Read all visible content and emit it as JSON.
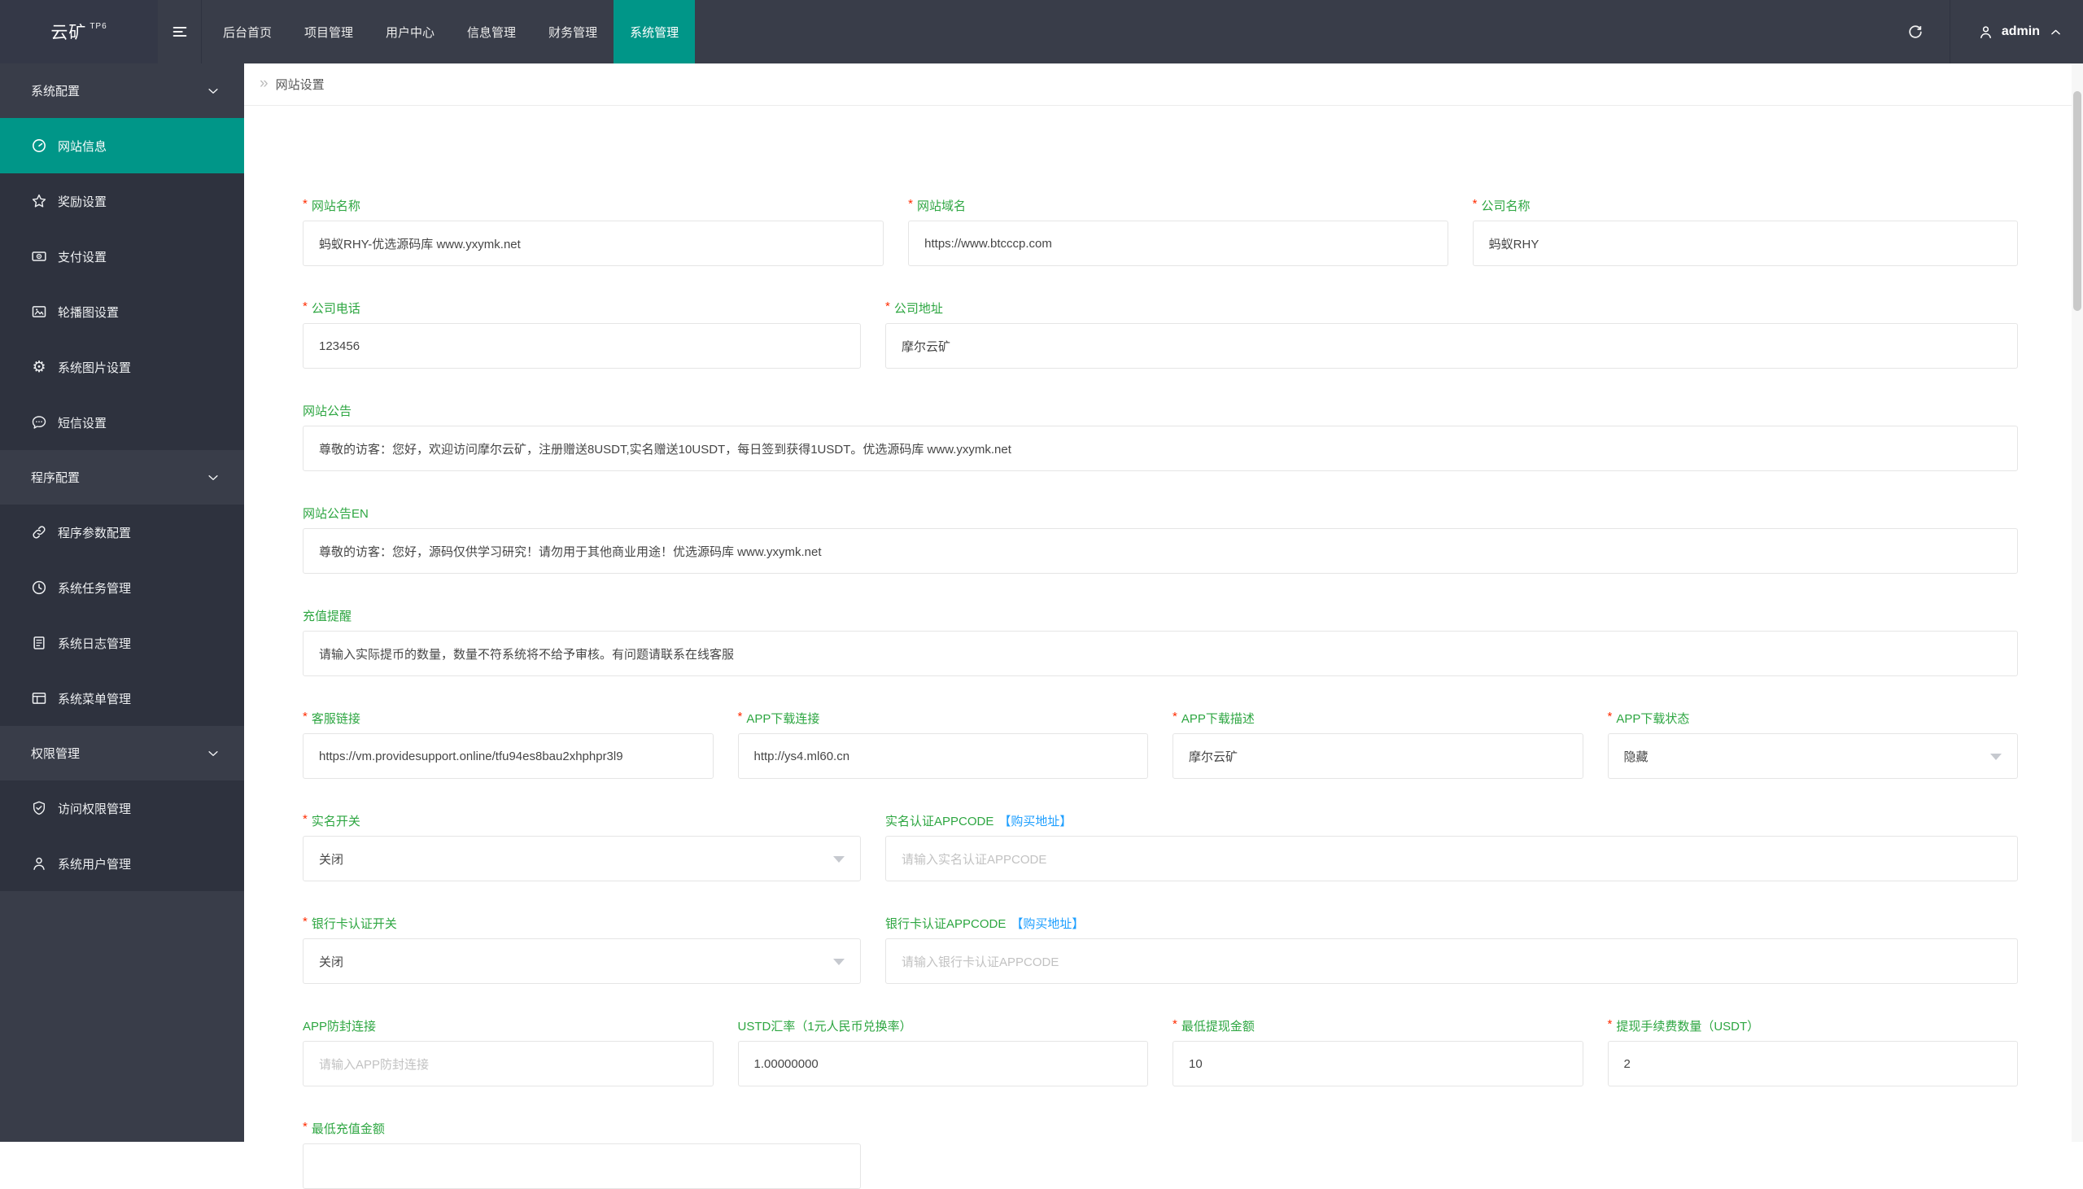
{
  "topbar": {
    "logo_text": "云矿",
    "logo_sup": "TP6",
    "nav": [
      {
        "id": "home",
        "label": "后台首页"
      },
      {
        "id": "project",
        "label": "项目管理"
      },
      {
        "id": "user",
        "label": "用户中心"
      },
      {
        "id": "info",
        "label": "信息管理"
      },
      {
        "id": "finance",
        "label": "财务管理"
      },
      {
        "id": "system",
        "label": "系统管理",
        "active": true
      }
    ],
    "user": "admin"
  },
  "sidebar": {
    "items": [
      {
        "type": "section",
        "id": "system-config",
        "label": "系统配置"
      },
      {
        "type": "item",
        "id": "site-info",
        "label": "网站信息",
        "icon": "gauge",
        "active": true
      },
      {
        "type": "item",
        "id": "reward-setting",
        "label": "奖励设置",
        "icon": "star"
      },
      {
        "type": "item",
        "id": "pay-setting",
        "label": "支付设置",
        "icon": "banknote"
      },
      {
        "type": "item",
        "id": "banner-setting",
        "label": "轮播图设置",
        "icon": "image"
      },
      {
        "type": "item",
        "id": "image-setting",
        "label": "系统图片设置",
        "icon": "gear"
      },
      {
        "type": "item",
        "id": "sms-setting",
        "label": "短信设置",
        "icon": "chat"
      },
      {
        "type": "section",
        "id": "program-config",
        "label": "程序配置"
      },
      {
        "type": "item",
        "id": "program-params",
        "label": "程序参数配置",
        "icon": "link"
      },
      {
        "type": "item",
        "id": "task-manage",
        "label": "系统任务管理",
        "icon": "clock"
      },
      {
        "type": "item",
        "id": "log-manage",
        "label": "系统日志管理",
        "icon": "log"
      },
      {
        "type": "item",
        "id": "menu-manage",
        "label": "系统菜单管理",
        "icon": "menu-window"
      },
      {
        "type": "section",
        "id": "permission",
        "label": "权限管理"
      },
      {
        "type": "item",
        "id": "access-manage",
        "label": "访问权限管理",
        "icon": "shield-check"
      },
      {
        "type": "item",
        "id": "sysuser-manage",
        "label": "系统用户管理",
        "icon": "user"
      }
    ]
  },
  "breadcrumb": {
    "arrow": "»",
    "title": "网站设置"
  },
  "form": {
    "required_marker": "*",
    "rows": [
      {
        "layout": "r3",
        "fields": [
          {
            "id": "site-name",
            "label": "网站名称",
            "required": true,
            "type": "text",
            "value": "蚂蚁RHY-优选源码库  www.yxymk.net"
          },
          {
            "id": "site-domain",
            "label": "网站域名",
            "required": true,
            "type": "text",
            "value": "https://www.btcccp.com"
          },
          {
            "id": "company-name",
            "label": "公司名称",
            "required": true,
            "type": "text",
            "value": "蚂蚁RHY"
          }
        ]
      },
      {
        "layout": "r2",
        "fields": [
          {
            "id": "company-phone",
            "label": "公司电话",
            "required": true,
            "type": "text",
            "value": "123456"
          },
          {
            "id": "company-address",
            "label": "公司地址",
            "required": true,
            "type": "text",
            "value": "摩尔云矿"
          }
        ]
      },
      {
        "layout": "r1",
        "fields": [
          {
            "id": "site-notice",
            "label": "网站公告",
            "type": "text",
            "value": "尊敬的访客：您好，欢迎访问摩尔云矿，注册赠送8USDT,实名赠送10USDT，每日签到获得1USDT。优选源码库  www.yxymk.net"
          }
        ]
      },
      {
        "layout": "r1",
        "fields": [
          {
            "id": "site-notice-en",
            "label": "网站公告EN",
            "type": "text",
            "value": "尊敬的访客：您好，源码仅供学习研究！请勿用于其他商业用途！优选源码库  www.yxymk.net"
          }
        ]
      },
      {
        "layout": "r1",
        "fields": [
          {
            "id": "recharge-notice",
            "label": "充值提醒",
            "type": "text",
            "value": "请输入实际提币的数量，数量不符系统将不给予审核。有问题请联系在线客服"
          }
        ]
      },
      {
        "layout": "r4",
        "fields": [
          {
            "id": "service-link",
            "label": "客服链接",
            "required": true,
            "type": "text",
            "value": "https://vm.providesupport.online/tfu94es8bau2xhphpr3l9"
          },
          {
            "id": "app-download-link",
            "label": "APP下载连接",
            "required": true,
            "type": "text",
            "value": "http://ys4.ml60.cn"
          },
          {
            "id": "app-download-desc",
            "label": "APP下载描述",
            "required": true,
            "type": "text",
            "value": "摩尔云矿"
          },
          {
            "id": "app-download-status",
            "label": "APP下载状态",
            "required": true,
            "type": "select",
            "value": "隐藏"
          }
        ]
      },
      {
        "layout": "r2",
        "fields": [
          {
            "id": "realname-switch",
            "label": "实名开关",
            "required": true,
            "type": "select",
            "value": "关闭"
          },
          {
            "id": "realname-appcode",
            "label": "实名认证APPCODE",
            "link": "【购买地址】",
            "type": "text",
            "placeholder": "请输入实名认证APPCODE"
          }
        ]
      },
      {
        "layout": "r2",
        "fields": [
          {
            "id": "bankcard-switch",
            "label": "银行卡认证开关",
            "required": true,
            "type": "select",
            "value": "关闭"
          },
          {
            "id": "bankcard-appcode",
            "label": "银行卡认证APPCODE ",
            "link": "【购买地址】",
            "type": "text",
            "placeholder": "请输入银行卡认证APPCODE"
          }
        ]
      },
      {
        "layout": "r4",
        "fields": [
          {
            "id": "app-antiblock-link",
            "label": "APP防封连接",
            "type": "text",
            "placeholder": "请输入APP防封连接"
          },
          {
            "id": "usdt-rate",
            "label": "USTD汇率（1元人民币兑换率）",
            "type": "text",
            "value": "1.00000000"
          },
          {
            "id": "min-withdraw",
            "label": "最低提现金额",
            "required": true,
            "type": "text",
            "value": "10"
          },
          {
            "id": "withdraw-fee",
            "label": "提现手续费数量（USDT）",
            "required": true,
            "type": "text",
            "value": "2"
          }
        ]
      },
      {
        "layout": "r2",
        "fields": [
          {
            "id": "min-recharge",
            "label": "最低充值金额",
            "required": true,
            "type": "text",
            "value": ""
          }
        ]
      }
    ]
  },
  "colors": {
    "accent_teal": "#009688",
    "topbar_dark": "#393d49",
    "sidebar_child_dark": "#2e323e",
    "label_green": "#2da641",
    "link_blue": "#1e9fff",
    "required_red": "#ff2b00"
  }
}
